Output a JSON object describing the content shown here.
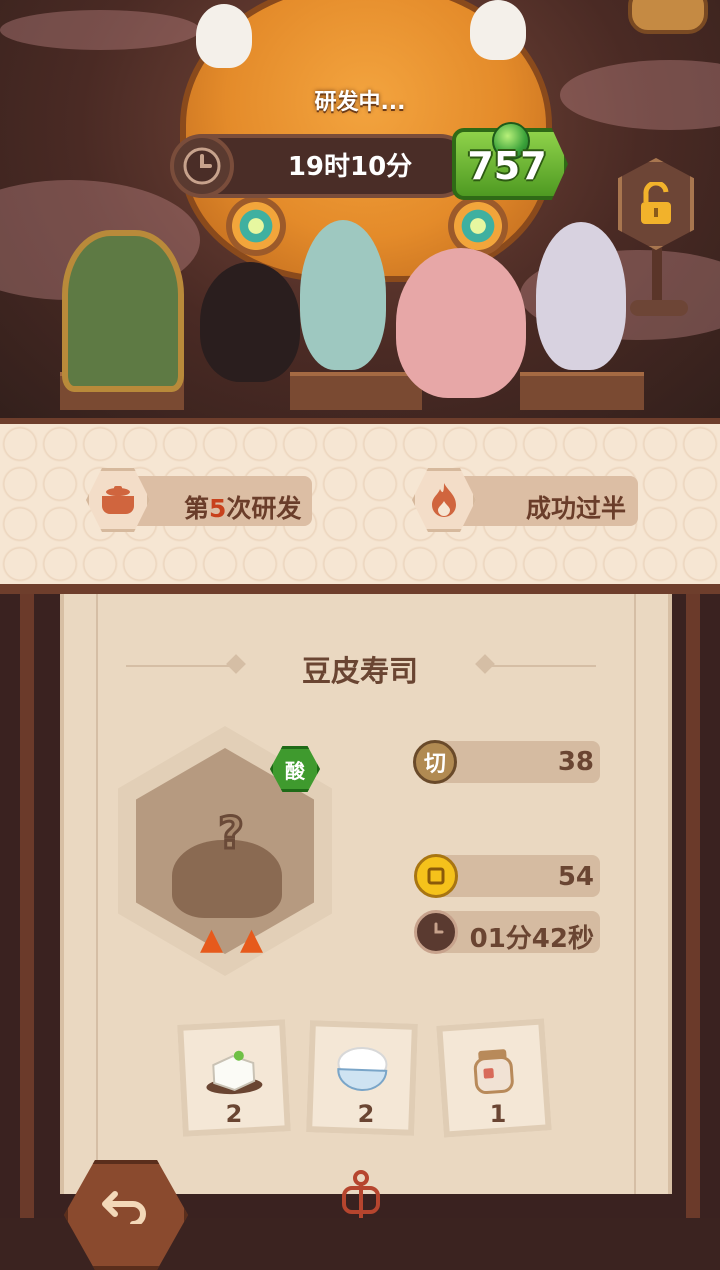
{
  "research": {
    "status": "研发中...",
    "timer": "19时10分",
    "speedup_cost": "757"
  },
  "info": {
    "attempt_prefix": "第",
    "attempt_number": "5",
    "attempt_suffix": "次研发",
    "progress": "成功过半"
  },
  "dish": {
    "name": "豆皮寿司",
    "flavor": "酸",
    "heat_level": 2
  },
  "stats": {
    "cut": {
      "label": "切",
      "value": "38"
    },
    "coins": {
      "value": "54"
    },
    "time": {
      "value": "01分42秒"
    }
  },
  "ingredients": [
    {
      "name": "tofu",
      "count": "2"
    },
    {
      "name": "rice",
      "count": "2"
    },
    {
      "name": "jar",
      "count": "1"
    }
  ],
  "colors": {
    "accent_green": "#4f9a22",
    "highlight_red": "#c8411c",
    "text_brown": "#6a4532"
  }
}
